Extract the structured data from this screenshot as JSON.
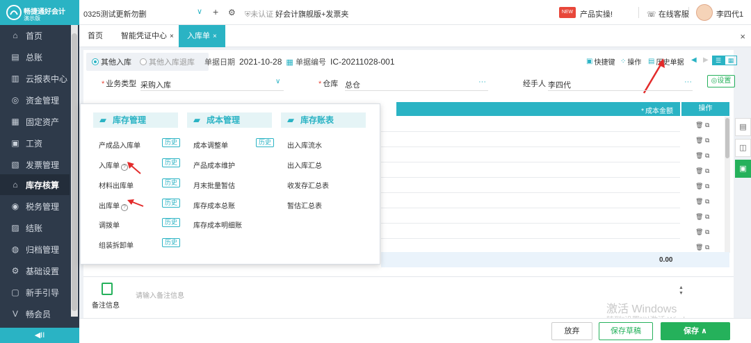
{
  "brand": {
    "name": "畅捷通好会计",
    "badge": "演示版"
  },
  "header": {
    "account": "0325测试更新勿删",
    "certification": "未认证",
    "edition": "好会计旗舰版+发票夹",
    "product_label": "产品实操!",
    "service": "在线客服",
    "user": "李四代1"
  },
  "sidebar": {
    "items": [
      {
        "label": "首页",
        "icon": "⌂"
      },
      {
        "label": "总账",
        "icon": "▤"
      },
      {
        "label": "云报表中心",
        "icon": "▥"
      },
      {
        "label": "资金管理",
        "icon": "◎"
      },
      {
        "label": "固定资产",
        "icon": "▦"
      },
      {
        "label": "工资",
        "icon": "▣"
      },
      {
        "label": "发票管理",
        "icon": "▧"
      },
      {
        "label": "库存核算",
        "icon": "⌂"
      },
      {
        "label": "税务管理",
        "icon": "◉"
      },
      {
        "label": "结账",
        "icon": "▨"
      },
      {
        "label": "归档管理",
        "icon": "◍"
      },
      {
        "label": "基础设置",
        "icon": "⚙"
      },
      {
        "label": "新手引导",
        "icon": "▢"
      },
      {
        "label": "畅会员",
        "icon": "V"
      }
    ],
    "collapse_icon": "◀II"
  },
  "tabs": {
    "home": "首页",
    "voucher": "智能凭证中心",
    "inbound": "入库单"
  },
  "form": {
    "radio_inbound": "其他入库",
    "radio_return": "其他入库退库",
    "date_label": "单据日期",
    "date_value": "2021-10-28",
    "no_label": "单据编号",
    "no_value": "IC-20211028-001",
    "tool_shortcut": "快捷键",
    "tool_ops": "操作",
    "tool_history": "历史单据",
    "biz_type_label": "业务类型",
    "biz_type_value": "采购入库",
    "warehouse_label": "仓库",
    "warehouse_value": "总仓",
    "handler_label": "经手人",
    "handler_value": "李四代",
    "settings": "设置"
  },
  "grid": {
    "cost_header": "成本金额",
    "ops_header": "操作",
    "total": "0.00"
  },
  "memo": {
    "label": "备注信息",
    "placeholder": "请输入备注信息"
  },
  "watermark": {
    "line1": "激活 Windows",
    "line2": "转到\"设置\"以激活 Windows。"
  },
  "actions": {
    "discard": "放弃",
    "draft": "保存草稿",
    "save": "保存 ∧"
  },
  "menu": {
    "col1": {
      "title": "库存管理",
      "items": [
        "产成品入库单",
        "入库单",
        "材料出库单",
        "出库单",
        "调拨单",
        "组装拆卸单"
      ]
    },
    "col2": {
      "title": "成本管理",
      "items": [
        "成本调整单",
        "产品成本维护",
        "月末批量暂估",
        "库存成本总账",
        "库存成本明细账"
      ]
    },
    "col3": {
      "title": "库存账表",
      "items": [
        "出入库流水",
        "出入库汇总",
        "收发存汇总表",
        "暂估汇总表"
      ]
    },
    "history": "历史"
  }
}
